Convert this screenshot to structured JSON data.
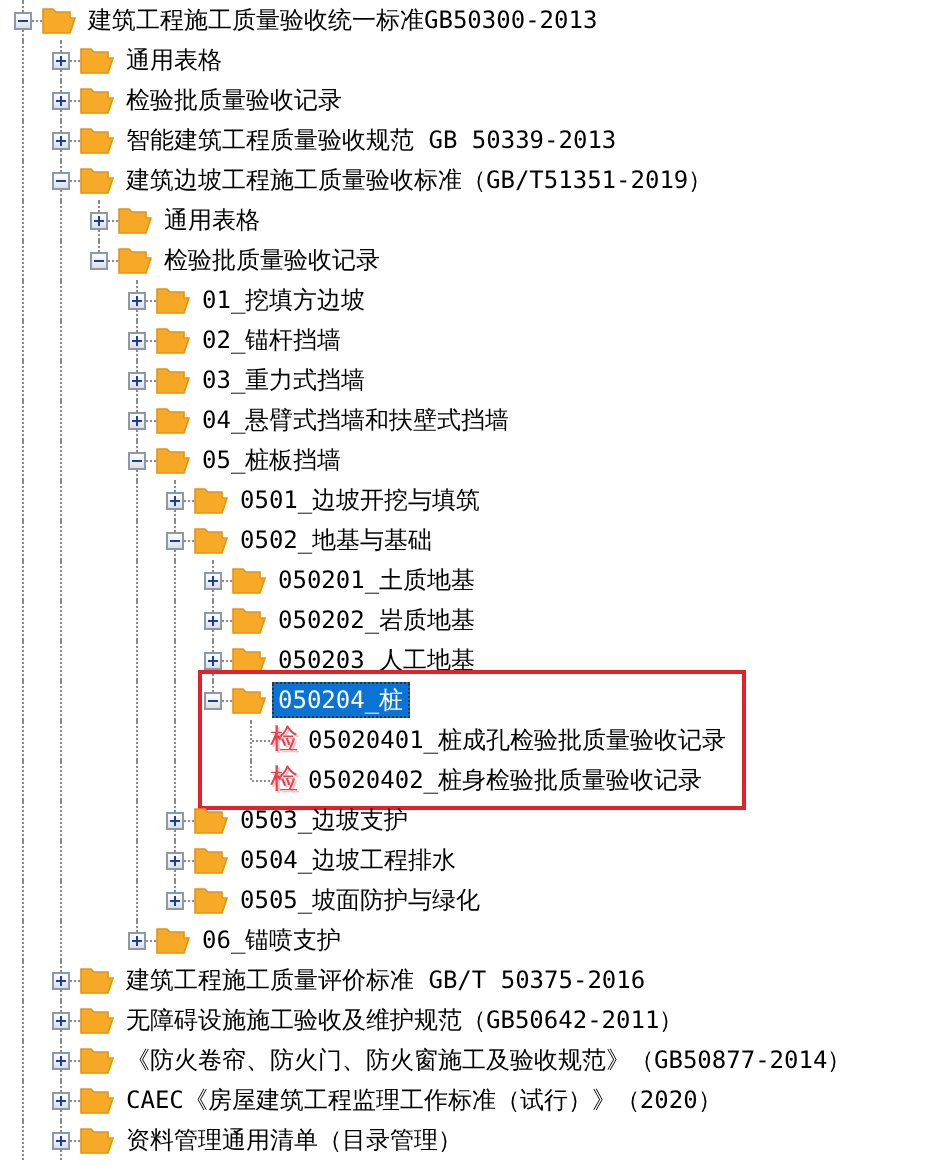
{
  "tree": [
    {
      "label": "建筑工程施工质量验收统一标准GB50300-2013",
      "kind": "folder",
      "expanded": true,
      "selected": false,
      "children": [
        {
          "label": "通用表格",
          "kind": "folder",
          "expanded": false,
          "selected": false
        },
        {
          "label": "检验批质量验收记录",
          "kind": "folder",
          "expanded": false,
          "selected": false
        },
        {
          "label": "智能建筑工程质量验收规范 GB 50339-2013",
          "kind": "folder",
          "expanded": false,
          "selected": false
        },
        {
          "label": "建筑边坡工程施工质量验收标准（GB/T51351-2019）",
          "kind": "folder",
          "expanded": true,
          "selected": false,
          "children": [
            {
              "label": "通用表格",
              "kind": "folder",
              "expanded": false,
              "selected": false
            },
            {
              "label": "检验批质量验收记录",
              "kind": "folder",
              "expanded": true,
              "selected": false,
              "children": [
                {
                  "label": "01_挖填方边坡",
                  "kind": "folder",
                  "expanded": false,
                  "selected": false
                },
                {
                  "label": "02_锚杆挡墙",
                  "kind": "folder",
                  "expanded": false,
                  "selected": false
                },
                {
                  "label": "03_重力式挡墙",
                  "kind": "folder",
                  "expanded": false,
                  "selected": false
                },
                {
                  "label": "04_悬臂式挡墙和扶壁式挡墙",
                  "kind": "folder",
                  "expanded": false,
                  "selected": false
                },
                {
                  "label": "05_桩板挡墙",
                  "kind": "folder",
                  "expanded": true,
                  "selected": false,
                  "children": [
                    {
                      "label": "0501_边坡开挖与填筑",
                      "kind": "folder",
                      "expanded": false,
                      "selected": false
                    },
                    {
                      "label": "0502_地基与基础",
                      "kind": "folder",
                      "expanded": true,
                      "selected": false,
                      "children": [
                        {
                          "label": "050201_土质地基",
                          "kind": "folder",
                          "expanded": false,
                          "selected": false
                        },
                        {
                          "label": "050202_岩质地基",
                          "kind": "folder",
                          "expanded": false,
                          "selected": false
                        },
                        {
                          "label": "050203_人工地基",
                          "kind": "folder",
                          "expanded": false,
                          "selected": false
                        },
                        {
                          "label": "050204_桩",
                          "kind": "folder",
                          "expanded": true,
                          "selected": true,
                          "outlined": true,
                          "children": [
                            {
                              "label": "05020401_桩成孔检验批质量验收记录",
                              "kind": "record",
                              "icon": "检",
                              "selected": false
                            },
                            {
                              "label": "05020402_桩身检验批质量验收记录",
                              "kind": "record",
                              "icon": "检",
                              "selected": false
                            }
                          ]
                        }
                      ]
                    },
                    {
                      "label": "0503_边坡支护",
                      "kind": "folder",
                      "expanded": false,
                      "selected": false
                    },
                    {
                      "label": "0504_边坡工程排水",
                      "kind": "folder",
                      "expanded": false,
                      "selected": false
                    },
                    {
                      "label": "0505_坡面防护与绿化",
                      "kind": "folder",
                      "expanded": false,
                      "selected": false
                    }
                  ]
                },
                {
                  "label": "06_锚喷支护",
                  "kind": "folder",
                  "expanded": false,
                  "selected": false
                }
              ]
            }
          ]
        },
        {
          "label": "建筑工程施工质量评价标准 GB/T 50375-2016",
          "kind": "folder",
          "expanded": false,
          "selected": false
        },
        {
          "label": "无障碍设施施工验收及维护规范（GB50642-2011）",
          "kind": "folder",
          "expanded": false,
          "selected": false
        },
        {
          "label": "《防火卷帘、防火门、防火窗施工及验收规范》（GB50877-2014）",
          "kind": "folder",
          "expanded": false,
          "selected": false
        },
        {
          "label": "CAEC《房屋建筑工程监理工作标准（试行）》（2020）",
          "kind": "folder",
          "expanded": false,
          "selected": false
        },
        {
          "label": "资料管理通用清单（目录管理）",
          "kind": "folder",
          "expanded": false,
          "selected": false
        }
      ]
    }
  ]
}
